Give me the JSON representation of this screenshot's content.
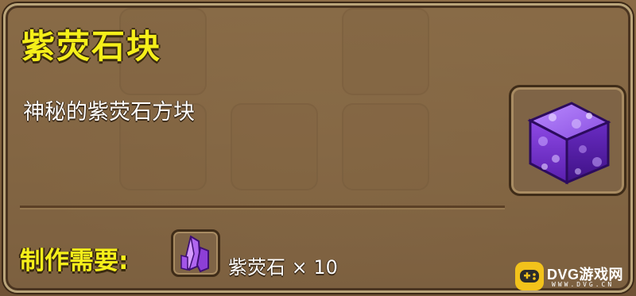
{
  "item": {
    "name": "紫荧石块",
    "description": "神秘的紫荧石方块",
    "icon": "purple-fluorite-block-icon"
  },
  "crafting": {
    "label": "制作需要:",
    "requirements": [
      {
        "name": "紫荧石",
        "quantity": "× 10",
        "icon": "purple-crystal-icon"
      }
    ]
  },
  "watermark": {
    "brand": "DVG游戏网",
    "sub": "WWW.DVG.CN"
  },
  "colors": {
    "title": "#f5ef1a",
    "panel_border": "#b9a47a",
    "cube_purple": "#7a2fd0"
  }
}
